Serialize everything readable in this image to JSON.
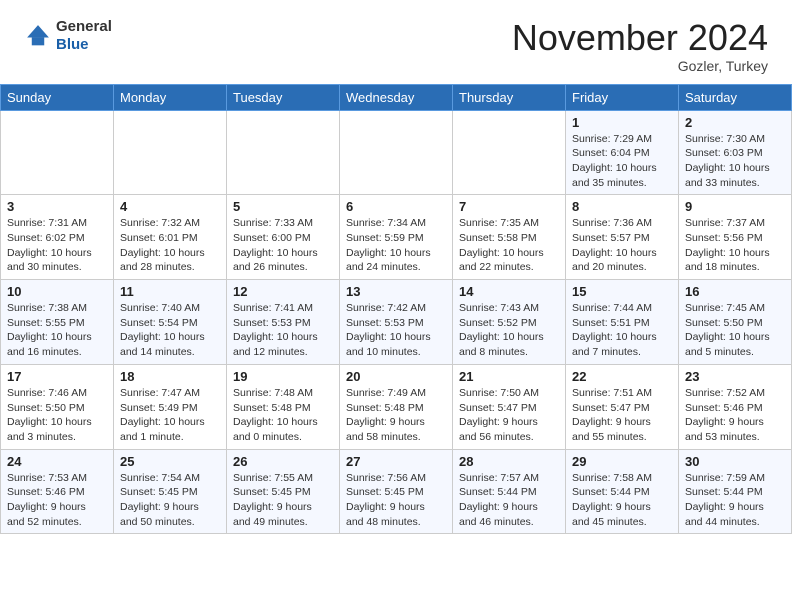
{
  "header": {
    "logo_line1": "General",
    "logo_line2": "Blue",
    "title": "November 2024",
    "subtitle": "Gozler, Turkey"
  },
  "weekdays": [
    "Sunday",
    "Monday",
    "Tuesday",
    "Wednesday",
    "Thursday",
    "Friday",
    "Saturday"
  ],
  "weeks": [
    [
      {
        "day": "",
        "info": ""
      },
      {
        "day": "",
        "info": ""
      },
      {
        "day": "",
        "info": ""
      },
      {
        "day": "",
        "info": ""
      },
      {
        "day": "",
        "info": ""
      },
      {
        "day": "1",
        "info": "Sunrise: 7:29 AM\nSunset: 6:04 PM\nDaylight: 10 hours\nand 35 minutes."
      },
      {
        "day": "2",
        "info": "Sunrise: 7:30 AM\nSunset: 6:03 PM\nDaylight: 10 hours\nand 33 minutes."
      }
    ],
    [
      {
        "day": "3",
        "info": "Sunrise: 7:31 AM\nSunset: 6:02 PM\nDaylight: 10 hours\nand 30 minutes."
      },
      {
        "day": "4",
        "info": "Sunrise: 7:32 AM\nSunset: 6:01 PM\nDaylight: 10 hours\nand 28 minutes."
      },
      {
        "day": "5",
        "info": "Sunrise: 7:33 AM\nSunset: 6:00 PM\nDaylight: 10 hours\nand 26 minutes."
      },
      {
        "day": "6",
        "info": "Sunrise: 7:34 AM\nSunset: 5:59 PM\nDaylight: 10 hours\nand 24 minutes."
      },
      {
        "day": "7",
        "info": "Sunrise: 7:35 AM\nSunset: 5:58 PM\nDaylight: 10 hours\nand 22 minutes."
      },
      {
        "day": "8",
        "info": "Sunrise: 7:36 AM\nSunset: 5:57 PM\nDaylight: 10 hours\nand 20 minutes."
      },
      {
        "day": "9",
        "info": "Sunrise: 7:37 AM\nSunset: 5:56 PM\nDaylight: 10 hours\nand 18 minutes."
      }
    ],
    [
      {
        "day": "10",
        "info": "Sunrise: 7:38 AM\nSunset: 5:55 PM\nDaylight: 10 hours\nand 16 minutes."
      },
      {
        "day": "11",
        "info": "Sunrise: 7:40 AM\nSunset: 5:54 PM\nDaylight: 10 hours\nand 14 minutes."
      },
      {
        "day": "12",
        "info": "Sunrise: 7:41 AM\nSunset: 5:53 PM\nDaylight: 10 hours\nand 12 minutes."
      },
      {
        "day": "13",
        "info": "Sunrise: 7:42 AM\nSunset: 5:53 PM\nDaylight: 10 hours\nand 10 minutes."
      },
      {
        "day": "14",
        "info": "Sunrise: 7:43 AM\nSunset: 5:52 PM\nDaylight: 10 hours\nand 8 minutes."
      },
      {
        "day": "15",
        "info": "Sunrise: 7:44 AM\nSunset: 5:51 PM\nDaylight: 10 hours\nand 7 minutes."
      },
      {
        "day": "16",
        "info": "Sunrise: 7:45 AM\nSunset: 5:50 PM\nDaylight: 10 hours\nand 5 minutes."
      }
    ],
    [
      {
        "day": "17",
        "info": "Sunrise: 7:46 AM\nSunset: 5:50 PM\nDaylight: 10 hours\nand 3 minutes."
      },
      {
        "day": "18",
        "info": "Sunrise: 7:47 AM\nSunset: 5:49 PM\nDaylight: 10 hours\nand 1 minute."
      },
      {
        "day": "19",
        "info": "Sunrise: 7:48 AM\nSunset: 5:48 PM\nDaylight: 10 hours\nand 0 minutes."
      },
      {
        "day": "20",
        "info": "Sunrise: 7:49 AM\nSunset: 5:48 PM\nDaylight: 9 hours\nand 58 minutes."
      },
      {
        "day": "21",
        "info": "Sunrise: 7:50 AM\nSunset: 5:47 PM\nDaylight: 9 hours\nand 56 minutes."
      },
      {
        "day": "22",
        "info": "Sunrise: 7:51 AM\nSunset: 5:47 PM\nDaylight: 9 hours\nand 55 minutes."
      },
      {
        "day": "23",
        "info": "Sunrise: 7:52 AM\nSunset: 5:46 PM\nDaylight: 9 hours\nand 53 minutes."
      }
    ],
    [
      {
        "day": "24",
        "info": "Sunrise: 7:53 AM\nSunset: 5:46 PM\nDaylight: 9 hours\nand 52 minutes."
      },
      {
        "day": "25",
        "info": "Sunrise: 7:54 AM\nSunset: 5:45 PM\nDaylight: 9 hours\nand 50 minutes."
      },
      {
        "day": "26",
        "info": "Sunrise: 7:55 AM\nSunset: 5:45 PM\nDaylight: 9 hours\nand 49 minutes."
      },
      {
        "day": "27",
        "info": "Sunrise: 7:56 AM\nSunset: 5:45 PM\nDaylight: 9 hours\nand 48 minutes."
      },
      {
        "day": "28",
        "info": "Sunrise: 7:57 AM\nSunset: 5:44 PM\nDaylight: 9 hours\nand 46 minutes."
      },
      {
        "day": "29",
        "info": "Sunrise: 7:58 AM\nSunset: 5:44 PM\nDaylight: 9 hours\nand 45 minutes."
      },
      {
        "day": "30",
        "info": "Sunrise: 7:59 AM\nSunset: 5:44 PM\nDaylight: 9 hours\nand 44 minutes."
      }
    ]
  ]
}
